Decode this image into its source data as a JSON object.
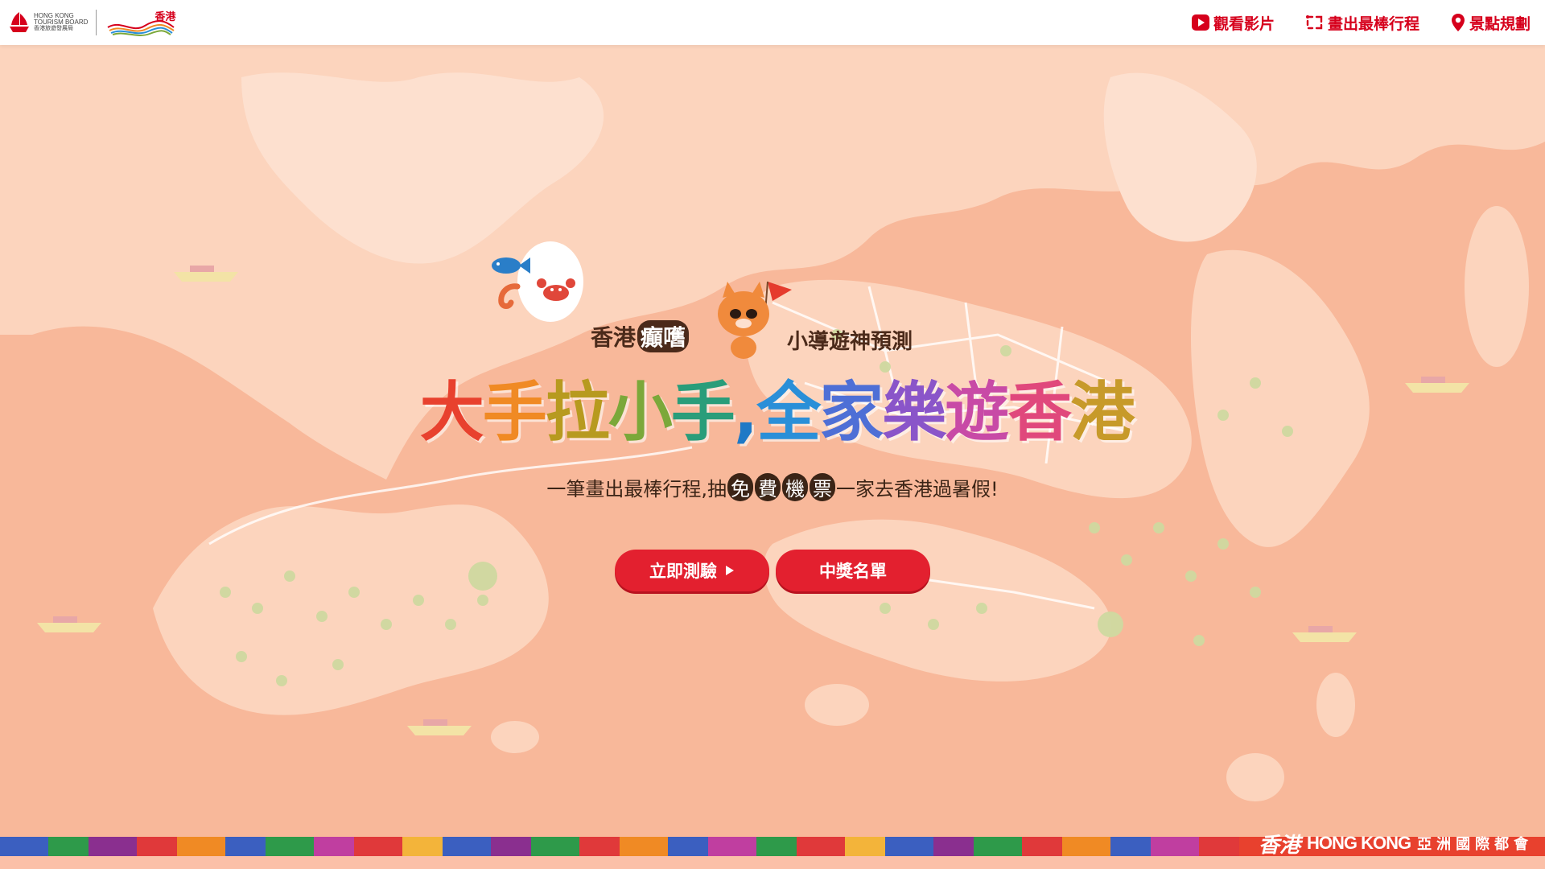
{
  "header": {
    "logo": {
      "en_line1": "HONG KONG",
      "en_line2": "TOURISM BOARD",
      "zh": "香港旅遊發展局",
      "brand_zh": "香港"
    },
    "nav": [
      {
        "label": "觀看影片",
        "icon": "play-icon"
      },
      {
        "label": "畫出最棒行程",
        "icon": "route-icon"
      },
      {
        "label": "景點規劃",
        "icon": "map-pin-icon"
      }
    ]
  },
  "hero": {
    "subtitle_left_prefix": "香港",
    "subtitle_left_highlight": "癲嚿",
    "subtitle_right": "小導遊神預測",
    "title_chars": [
      {
        "ch": "大",
        "color": "#e8412e"
      },
      {
        "ch": "手",
        "color": "#f08a24"
      },
      {
        "ch": "拉",
        "color": "#b79a1f"
      },
      {
        "ch": "小",
        "color": "#7ba83a"
      },
      {
        "ch": "手",
        "color": "#2a9d7a"
      },
      {
        "ch": ",",
        "color": "#1f79c6"
      },
      {
        "ch": "全",
        "color": "#2a8fd8"
      },
      {
        "ch": "家",
        "color": "#4e6fd6"
      },
      {
        "ch": "樂",
        "color": "#8a55c9"
      },
      {
        "ch": "遊",
        "color": "#c84aa6"
      },
      {
        "ch": "香",
        "color": "#e0487c"
      },
      {
        "ch": "港",
        "color": "#c79a2a"
      }
    ],
    "tagline_before": "一筆畫出最棒行程,抽",
    "tagline_highlights": [
      "免",
      "費",
      "機",
      "票"
    ],
    "tagline_after": "一家去香港過暑假!"
  },
  "buttons": {
    "quiz": "立即測驗",
    "winners": "中獎名單"
  },
  "footer": {
    "brand_script": "香港",
    "brand_en": "HONG KONG",
    "brand_zh": "亞洲國際都會"
  },
  "colors": {
    "primary_red": "#d6001c",
    "button_red": "#e3202f",
    "map_sea": "#f8b89a",
    "map_land": "#fcd4bd",
    "brown_text": "#4b2a1a"
  }
}
